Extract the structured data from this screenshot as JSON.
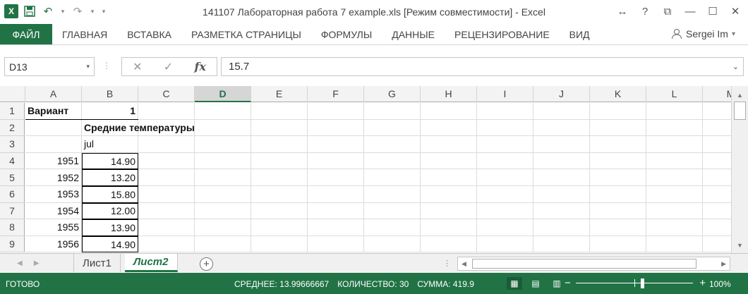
{
  "window": {
    "title": "141107 Лабораторная работа 7 example.xls  [Режим совместимости] - Excel",
    "controls": [
      "↔",
      "?",
      "⧉",
      "—",
      "☐",
      "✕"
    ]
  },
  "qat": {
    "logo": "X",
    "save": "💾",
    "undo": "↶",
    "redo": "↷",
    "customize": "▾"
  },
  "ribbon": {
    "tabs": [
      "ФАЙЛ",
      "ГЛАВНАЯ",
      "ВСТАВКА",
      "РАЗМЕТКА СТРАНИЦЫ",
      "ФОРМУЛЫ",
      "ДАННЫЕ",
      "РЕЦЕНЗИРОВАНИЕ",
      "ВИД"
    ],
    "user": "Sergei Im",
    "user_caret": "▾",
    "minimize": "▲"
  },
  "formula_bar": {
    "name_box": "D13",
    "name_box_caret": "▾",
    "dots": "⋮",
    "cancel": "✕",
    "enter": "✓",
    "fx": "fx",
    "value": "15.7",
    "expand": "⌄"
  },
  "grid": {
    "corner": "",
    "columns": [
      "A",
      "B",
      "C",
      "D",
      "E",
      "F",
      "G",
      "H",
      "I",
      "J",
      "K",
      "L",
      "M"
    ],
    "active_column": "D",
    "rows": [
      "1",
      "2",
      "3",
      "4",
      "5",
      "6",
      "7",
      "8",
      "9"
    ],
    "cells": {
      "A1": "Вариант",
      "B1": "1",
      "B2": "Средние температуры",
      "B3": "jul",
      "A4": "1951",
      "B4": "14.90",
      "A5": "1952",
      "B5": "13.20",
      "A6": "1953",
      "B6": "15.80",
      "A7": "1954",
      "B7": "12.00",
      "A8": "1955",
      "B8": "13.90",
      "A9": "1956",
      "B9": "14.90"
    }
  },
  "sheets": {
    "nav_prev": "◀",
    "nav_next": "▶",
    "tabs": [
      "Лист1",
      "Лист2"
    ],
    "active": "Лист2",
    "add": "+",
    "dots": "⋮",
    "hscroll_left": "◀",
    "hscroll_right": "▶"
  },
  "vscroll": {
    "up": "▲",
    "down": "▼"
  },
  "status": {
    "ready": "ГОТОВО",
    "average": "СРЕДНЕЕ: 13.99666667",
    "count": "КОЛИЧЕСТВО: 30",
    "sum": "СУММА: 419.9",
    "views": [
      "▦",
      "▤",
      "▥"
    ],
    "zoom_minus": "−",
    "zoom_plus": "+",
    "zoom": "100%",
    "zoom_level": 1.0
  },
  "colors": {
    "accent": "#217346",
    "grid_line": "#dadcdd",
    "header_bg": "#f3f3f3"
  }
}
